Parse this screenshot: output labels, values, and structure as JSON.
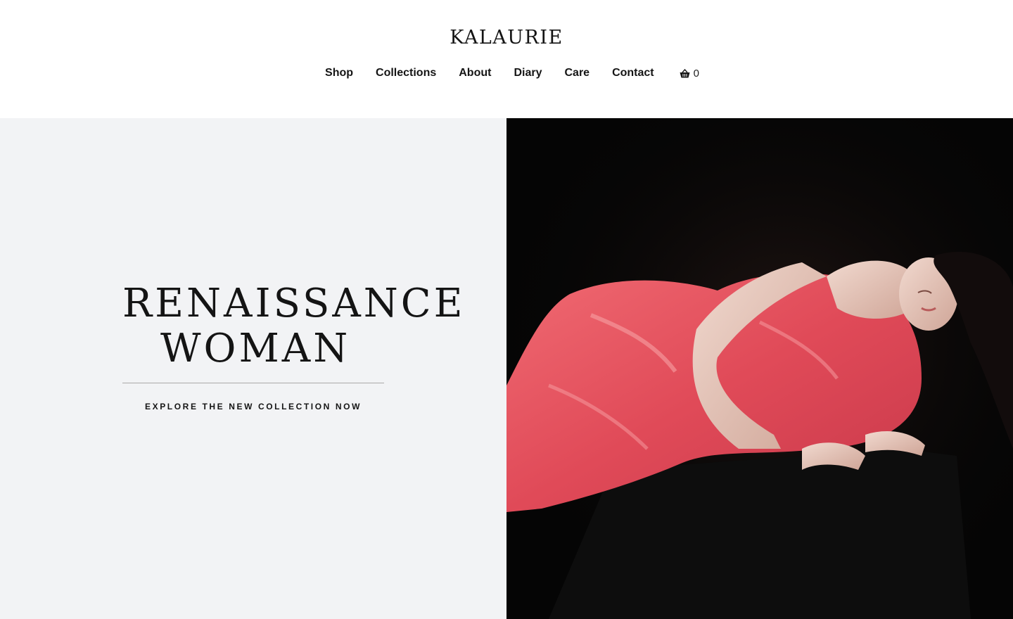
{
  "brand": {
    "name": "KALAURIE"
  },
  "nav": {
    "items": [
      {
        "label": "Shop"
      },
      {
        "label": "Collections"
      },
      {
        "label": "About"
      },
      {
        "label": "Diary"
      },
      {
        "label": "Care"
      },
      {
        "label": "Contact"
      }
    ],
    "cart": {
      "icon": "basket-icon",
      "count": "0"
    }
  },
  "hero": {
    "headline_line1": "RENAISSANCE",
    "headline_line2": "WOMAN",
    "cta": "EXPLORE THE NEW COLLECTION NOW",
    "image": {
      "subject": "model-in-red-satin-dress",
      "dress_color": "#e5535f",
      "background_color": "#050505"
    }
  },
  "colors": {
    "panel_bg": "#f2f3f5",
    "text": "#141414",
    "divider": "#a9a9a9"
  }
}
